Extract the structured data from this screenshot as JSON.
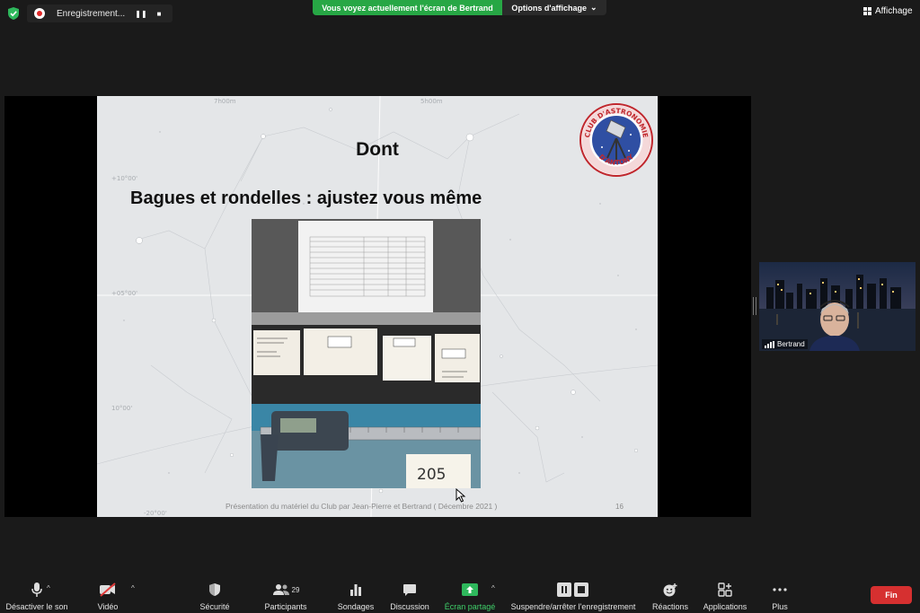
{
  "topbar": {
    "recording_label": "Enregistrement...",
    "pause_glyph": "❚❚",
    "stop_glyph": "■",
    "share_banner": "Vous voyez actuellement l'écran de Bertrand",
    "view_options": "Options d'affichage",
    "view_options_chevron": "⌄",
    "view_toggle": "Affichage"
  },
  "slide": {
    "title": "Dont",
    "subtitle": "Bagues et rondelles : ajustez vous même",
    "footer": "Présentation du matériel du Club par Jean-Pierre et Bertrand ( Décembre 2021 )",
    "page_number": "16",
    "logo_text": "CLUB D'ASTRONOMIE D'ANTONY",
    "photo_tag": "205"
  },
  "participant": {
    "name": "Bertrand"
  },
  "toolbar": {
    "mute_label": "Désactiver le son",
    "video_label": "Vidéo",
    "security_label": "Sécurité",
    "participants_label": "Participants",
    "participants_count": "29",
    "polls_label": "Sondages",
    "chat_label": "Discussion",
    "share_label": "Écran partagé",
    "record_label": "Suspendre/arrêter l'enregistrement",
    "reactions_label": "Réactions",
    "apps_label": "Applications",
    "more_label": "Plus",
    "end_label": "Fin",
    "caret_glyph": "^"
  },
  "colors": {
    "share_green": "#27a745",
    "end_red": "#d63030",
    "background": "#1a1a1a"
  }
}
